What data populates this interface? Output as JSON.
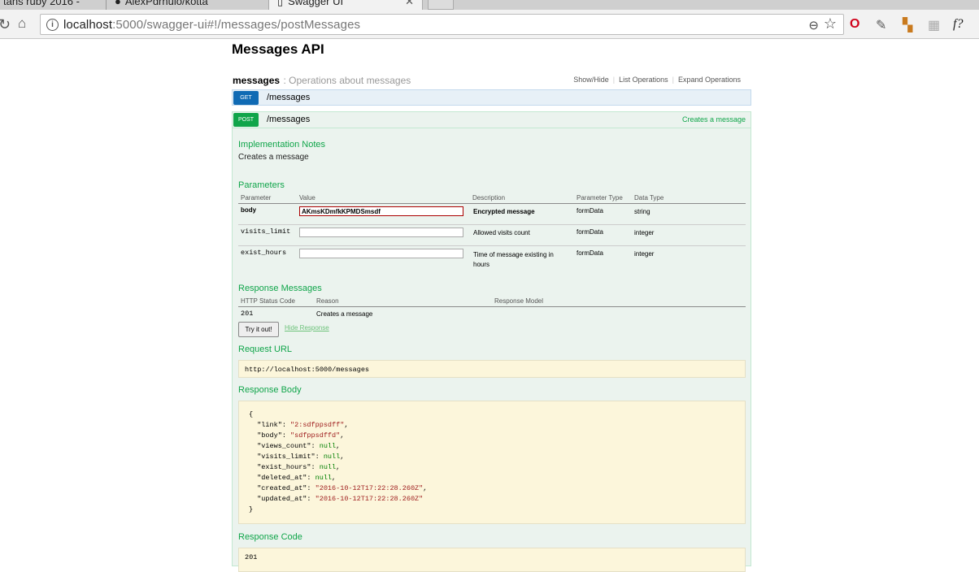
{
  "browser": {
    "tabs": [
      {
        "label": "tans ruby 2016 -"
      },
      {
        "label": "AlexPdrnulo/kotta"
      },
      {
        "label": "Swagger UI"
      }
    ],
    "url_host": "localhost",
    "url_rest": ":5000/swagger-ui#!/messages/postMessages"
  },
  "api_title": "Messages API",
  "resource": {
    "name": "messages",
    "description": ": Operations about messages",
    "ops": [
      "Show/Hide",
      "List Operations",
      "Expand Operations"
    ]
  },
  "operations": {
    "get": {
      "verb": "GET",
      "path": "/messages"
    },
    "post": {
      "verb": "POST",
      "path": "/messages",
      "summary": "Creates a message"
    }
  },
  "implementation": {
    "heading": "Implementation Notes",
    "note": "Creates a message"
  },
  "parameters": {
    "heading": "Parameters",
    "headers": [
      "Parameter",
      "Value",
      "Description",
      "Parameter Type",
      "Data Type"
    ],
    "rows": [
      {
        "name": "body",
        "value": "AKmsKDmfkKPMDSmsdf",
        "description": "Encrypted message",
        "ptype": "formData",
        "dtype": "string"
      },
      {
        "name": "visits_limit",
        "value": "",
        "description": "Allowed visits count",
        "ptype": "formData",
        "dtype": "integer"
      },
      {
        "name": "exist_hours",
        "value": "",
        "description": "Time of message existing in hours",
        "ptype": "formData",
        "dtype": "integer"
      }
    ]
  },
  "responses": {
    "heading": "Response Messages",
    "headers": [
      "HTTP Status Code",
      "Reason",
      "Response Model"
    ],
    "rows": [
      {
        "code": "201",
        "reason": "Creates a message",
        "model": ""
      }
    ]
  },
  "try_label": "Try it out!",
  "hide_response_label": "Hide Response",
  "request_url": {
    "heading": "Request URL",
    "value": "http://localhost:5000/messages"
  },
  "response_body": {
    "heading": "Response Body",
    "open": "{",
    "close": "}",
    "fields": [
      {
        "key": "\"link\"",
        "value": "\"2:sdfppsdff\"",
        "kind": "str",
        "comma": ","
      },
      {
        "key": "\"body\"",
        "value": "\"sdfppsdffd\"",
        "kind": "str",
        "comma": ","
      },
      {
        "key": "\"views_count\"",
        "value": "null",
        "kind": "lit",
        "comma": ","
      },
      {
        "key": "\"visits_limit\"",
        "value": "null",
        "kind": "lit",
        "comma": ","
      },
      {
        "key": "\"exist_hours\"",
        "value": "null",
        "kind": "lit",
        "comma": ","
      },
      {
        "key": "\"deleted_at\"",
        "value": "null",
        "kind": "lit",
        "comma": ","
      },
      {
        "key": "\"created_at\"",
        "value": "\"2016-10-12T17:22:28.260Z\"",
        "kind": "str",
        "comma": ","
      },
      {
        "key": "\"updated_at\"",
        "value": "\"2016-10-12T17:22:28.260Z\"",
        "kind": "str",
        "comma": ""
      }
    ]
  },
  "response_code": {
    "heading": "Response Code",
    "value": "201"
  }
}
